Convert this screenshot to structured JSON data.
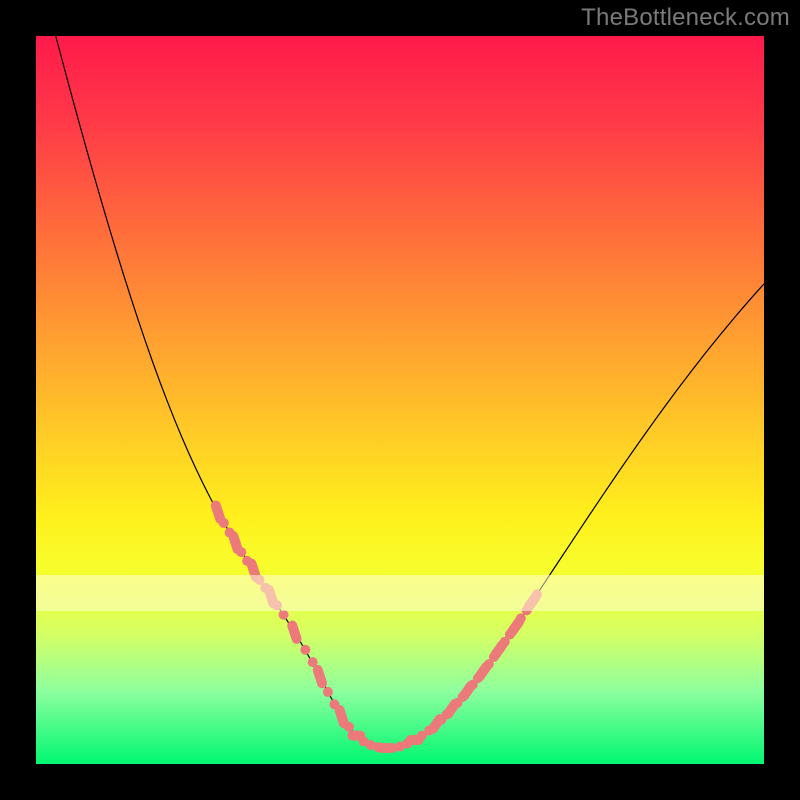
{
  "attribution": "TheBottleneck.com",
  "chart_data": {
    "type": "line",
    "title": "",
    "xlabel": "",
    "ylabel": "",
    "xlim": [
      0,
      100
    ],
    "ylim": [
      0,
      100
    ],
    "x": [
      0,
      1,
      2,
      3,
      4,
      5,
      6,
      7,
      8,
      9,
      10,
      11,
      12,
      13,
      14,
      15,
      16,
      17,
      18,
      19,
      20,
      21,
      22,
      23,
      24,
      25,
      26,
      27,
      28,
      29,
      30,
      31,
      32,
      33,
      34,
      35,
      36,
      37,
      38,
      39,
      40,
      41,
      42,
      43,
      44,
      45,
      46,
      47,
      48,
      49,
      50,
      51,
      52,
      53,
      54,
      55,
      56,
      57,
      58,
      59,
      60,
      61,
      62,
      63,
      64,
      65,
      66,
      67,
      68,
      69,
      70,
      71,
      72,
      73,
      74,
      75,
      76,
      77,
      78,
      79,
      80,
      81,
      82,
      83,
      84,
      85,
      86,
      87,
      88,
      89,
      90,
      91,
      92,
      93,
      94,
      95,
      96,
      97,
      98,
      99,
      100
    ],
    "values": [
      110.33,
      106.49,
      102.68,
      98.9,
      95.16,
      91.46,
      87.82,
      84.23,
      80.7,
      77.24,
      73.85,
      70.53,
      67.3,
      64.15,
      61.1,
      58.14,
      55.29,
      52.54,
      49.91,
      47.38,
      44.97,
      42.67,
      40.48,
      38.41,
      36.44,
      34.57,
      32.8,
      31.11,
      29.5,
      27.94,
      26.43,
      24.95,
      23.47,
      21.99,
      20.47,
      18.92,
      17.3,
      15.61,
      13.84,
      12.0,
      10.1,
      8.24,
      6.54,
      5.09,
      3.94,
      3.11,
      2.57,
      2.28,
      2.18,
      2.24,
      2.45,
      2.8,
      3.29,
      3.9,
      4.63,
      5.46,
      6.39,
      7.41,
      8.51,
      9.67,
      10.9,
      12.18,
      13.5,
      14.87,
      16.27,
      17.7,
      19.15,
      20.62,
      22.11,
      23.61,
      25.11,
      26.63,
      28.14,
      29.65,
      31.16,
      32.67,
      34.17,
      35.66,
      37.15,
      38.62,
      40.09,
      41.54,
      42.98,
      44.4,
      45.81,
      47.21,
      48.59,
      49.95,
      51.3,
      52.62,
      53.93,
      55.22,
      56.5,
      57.75,
      58.98,
      60.19,
      61.39,
      62.56,
      63.71,
      64.84,
      65.95
    ],
    "highlight_band_y": [
      21,
      26
    ],
    "marker_series": {
      "left": [
        {
          "x": 25.0,
          "y": 34.6
        },
        {
          "x": 25.8,
          "y": 33.1
        },
        {
          "x": 26.6,
          "y": 31.8
        },
        {
          "x": 27.4,
          "y": 30.4
        },
        {
          "x": 28.2,
          "y": 29.1
        },
        {
          "x": 29.0,
          "y": 27.9
        },
        {
          "x": 29.9,
          "y": 26.6
        },
        {
          "x": 30.7,
          "y": 25.3
        },
        {
          "x": 31.5,
          "y": 24.2
        },
        {
          "x": 32.3,
          "y": 23.0
        },
        {
          "x": 33.1,
          "y": 21.8
        },
        {
          "x": 34.0,
          "y": 20.5
        },
        {
          "x": 35.5,
          "y": 18.1
        },
        {
          "x": 37.0,
          "y": 15.7
        },
        {
          "x": 38.0,
          "y": 14.0
        },
        {
          "x": 39.0,
          "y": 12.0
        },
        {
          "x": 40.1,
          "y": 9.9
        },
        {
          "x": 41.0,
          "y": 8.2
        },
        {
          "x": 42.0,
          "y": 6.5
        },
        {
          "x": 43.0,
          "y": 5.1
        }
      ],
      "bottom": [
        {
          "x": 44.0,
          "y": 3.9
        },
        {
          "x": 45.0,
          "y": 3.1
        },
        {
          "x": 46.0,
          "y": 2.6
        },
        {
          "x": 47.0,
          "y": 2.3
        },
        {
          "x": 48.0,
          "y": 2.2
        },
        {
          "x": 49.0,
          "y": 2.2
        },
        {
          "x": 50.0,
          "y": 2.4
        },
        {
          "x": 51.0,
          "y": 2.8
        },
        {
          "x": 52.0,
          "y": 3.3
        },
        {
          "x": 53.0,
          "y": 3.9
        },
        {
          "x": 54.0,
          "y": 4.6
        }
      ],
      "right": [
        {
          "x": 55.0,
          "y": 5.5
        },
        {
          "x": 55.7,
          "y": 6.1
        },
        {
          "x": 56.4,
          "y": 6.8
        },
        {
          "x": 57.1,
          "y": 7.6
        },
        {
          "x": 57.9,
          "y": 8.4
        },
        {
          "x": 58.6,
          "y": 9.2
        },
        {
          "x": 59.3,
          "y": 10.1
        },
        {
          "x": 60.0,
          "y": 10.9
        },
        {
          "x": 60.7,
          "y": 11.8
        },
        {
          "x": 61.4,
          "y": 12.7
        },
        {
          "x": 62.2,
          "y": 13.7
        },
        {
          "x": 62.9,
          "y": 14.7
        },
        {
          "x": 63.6,
          "y": 15.7
        },
        {
          "x": 64.4,
          "y": 16.8
        },
        {
          "x": 65.1,
          "y": 17.8
        },
        {
          "x": 65.9,
          "y": 18.9
        },
        {
          "x": 66.6,
          "y": 20.0
        },
        {
          "x": 67.4,
          "y": 21.1
        },
        {
          "x": 68.1,
          "y": 22.2
        },
        {
          "x": 68.8,
          "y": 23.3
        }
      ]
    }
  }
}
